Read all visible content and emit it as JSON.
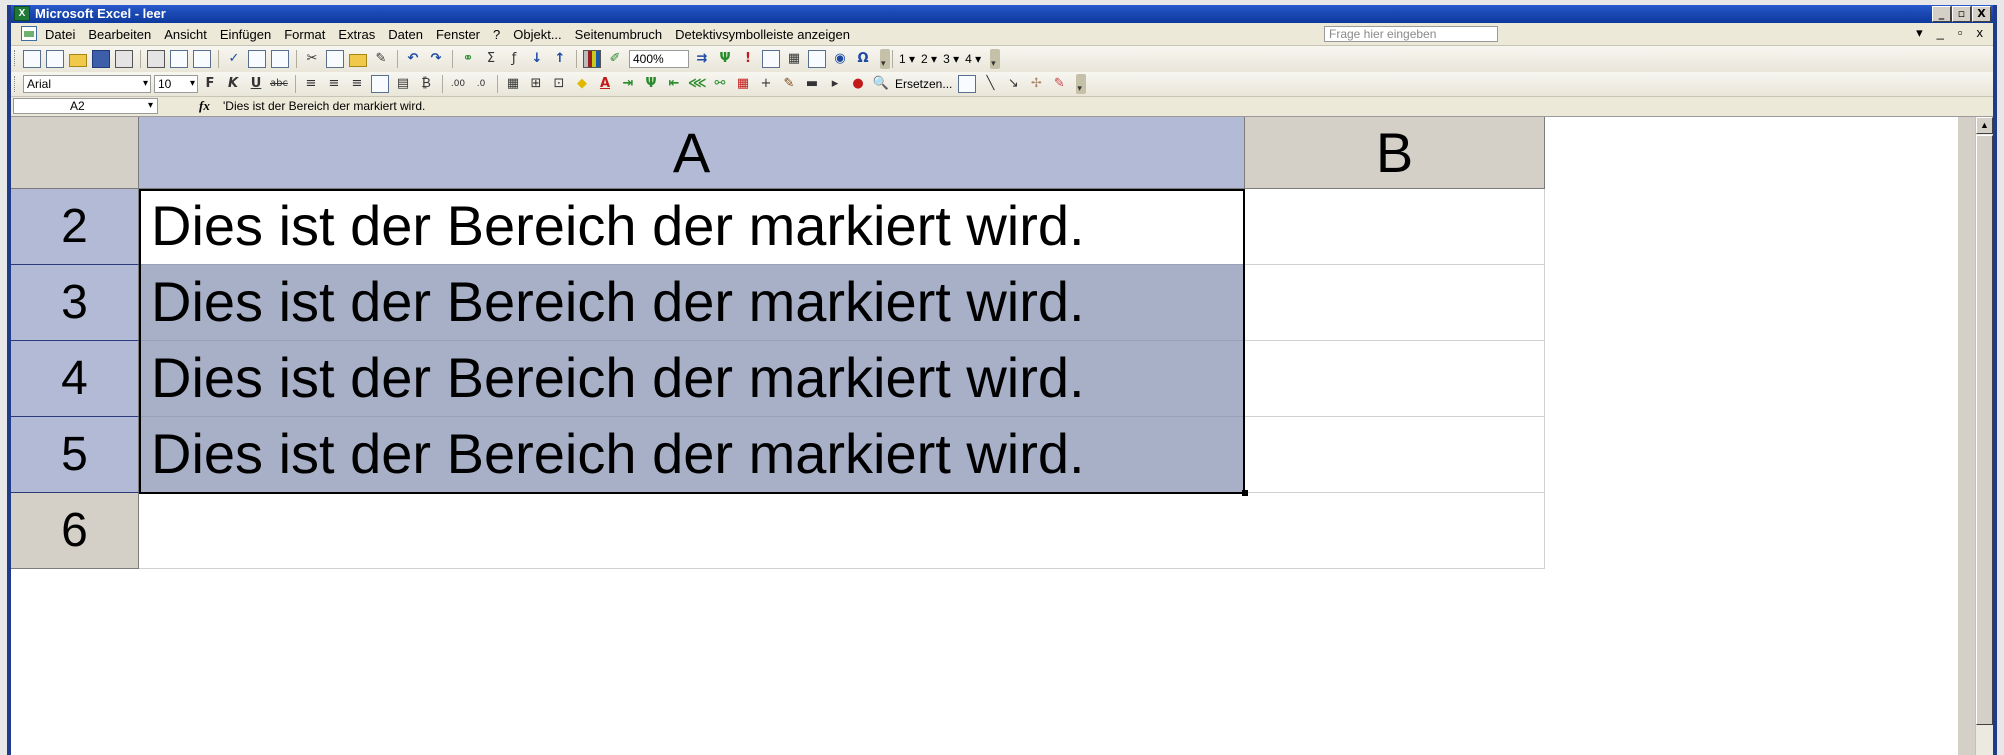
{
  "window": {
    "title": "Microsoft Excel - leer",
    "controls": [
      "_",
      "▫",
      "X"
    ]
  },
  "menubar": {
    "items": [
      "Datei",
      "Bearbeiten",
      "Ansicht",
      "Einfügen",
      "Format",
      "Extras",
      "Daten",
      "Fenster",
      "?",
      "Objekt...",
      "Seitenumbruch",
      "Detektivsymbolleiste anzeigen"
    ],
    "help_placeholder": "Frage hier eingeben",
    "doc_controls": [
      "▾",
      "_",
      "▫",
      "x"
    ]
  },
  "toolbar_standard": {
    "zoom": "400%",
    "outline_levels": [
      "1 ▾",
      "2 ▾",
      "3 ▾",
      "4 ▾"
    ]
  },
  "toolbar_format": {
    "font_name": "Arial",
    "font_size": "10",
    "replace_label": "Ersetzen..."
  },
  "formula_bar": {
    "name_box": "A2",
    "fx_label": "fx",
    "formula": "'Dies ist der Bereich der markiert wird."
  },
  "sheet": {
    "columns": [
      "A",
      "B"
    ],
    "rows": [
      {
        "number": "2",
        "a": "Dies ist der Bereich der markiert wird."
      },
      {
        "number": "3",
        "a": "Dies ist der Bereich der markiert wird."
      },
      {
        "number": "4",
        "a": "Dies ist der Bereich der markiert wird."
      },
      {
        "number": "5",
        "a": "Dies ist der Bereich der markiert wird."
      },
      {
        "number": "6",
        "a": ""
      }
    ]
  },
  "colors": {
    "title_bar": "#0e3a9e",
    "selection_fill": "#a8b0c8",
    "selected_header": "#b2bad6"
  }
}
